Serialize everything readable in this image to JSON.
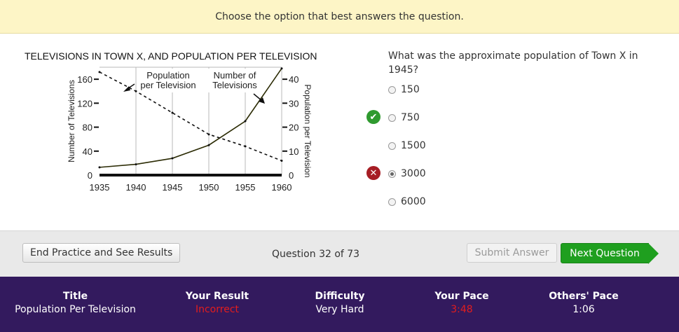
{
  "banner": {
    "text": "Choose the option that best answers the question."
  },
  "chart": {
    "title": "TELEVISIONS IN TOWN X, AND POPULATION PER TELEVISION",
    "ylabel_left": "Number of Televisions",
    "ylabel_right": "Population per Television",
    "left_ticks": [
      "0",
      "40",
      "80",
      "120",
      "160"
    ],
    "right_ticks": [
      "0",
      "10",
      "20",
      "30",
      "40"
    ],
    "x_ticks": [
      "1935",
      "1940",
      "1945",
      "1950",
      "1955",
      "1960"
    ],
    "annotations": {
      "population_line1": "Population",
      "population_line2": "per Television",
      "tvs_line1": "Number of",
      "tvs_line2": "Televisions"
    }
  },
  "chart_data": {
    "type": "line",
    "title": "TELEVISIONS IN TOWN X, AND POPULATION PER TELEVISION",
    "x": [
      1935,
      1940,
      1945,
      1950,
      1955,
      1960
    ],
    "series": [
      {
        "name": "Number of Televisions",
        "axis": "left",
        "style": "solid",
        "values": [
          13,
          18,
          28,
          50,
          90,
          178
        ]
      },
      {
        "name": "Population per Television",
        "axis": "right",
        "style": "dashed",
        "values": [
          43,
          35,
          26,
          17,
          12,
          6
        ]
      }
    ],
    "xlabel": "",
    "ylabel_left": "Number of Televisions",
    "ylabel_right": "Population per Television",
    "ylim_left": [
      0,
      180
    ],
    "ylim_right": [
      0,
      45
    ],
    "grid": "vertical"
  },
  "question": {
    "text": "What was the approximate population of Town X in 1945?",
    "options": [
      "150",
      "750",
      "1500",
      "3000",
      "6000"
    ]
  },
  "controls": {
    "end_label": "End Practice and See Results",
    "counter": "Question 32 of 73",
    "submit_label": "Submit Answer",
    "next_label": "Next Question"
  },
  "footer": {
    "title_header": "Title",
    "title_value": "Population Per Television",
    "result_header": "Your Result",
    "result_value": "Incorrect",
    "difficulty_header": "Difficulty",
    "difficulty_value": "Very Hard",
    "pace_header": "Your Pace",
    "pace_value": "3:48",
    "others_header": "Others' Pace",
    "others_value": "1:06"
  },
  "colors": {
    "correct": "#2f9a2f",
    "incorrect": "#a61d24",
    "next_button": "#1f9f1f",
    "footer_bg": "#331a5e"
  }
}
